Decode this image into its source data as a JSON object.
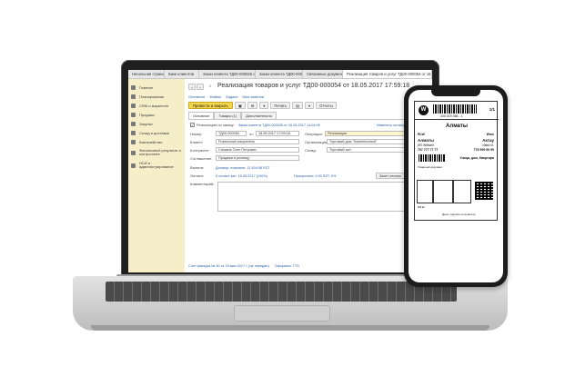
{
  "laptop_app": {
    "tabs": [
      "Начальная страница",
      "Банк клиентов",
      "Заказ клиента ТД00-000026 от 16.05.2017 14:04:09",
      "Заказ клиента ТД00-000026 от ...",
      "Связанные документы",
      "Реализация товаров и услуг ТД00-000054 от 18.05.2017 17:59:18"
    ],
    "sidebar": [
      {
        "label": "Главное"
      },
      {
        "label": "Планирование"
      },
      {
        "label": "CRM и маркетинг"
      },
      {
        "label": "Продажи"
      },
      {
        "label": "Закупки"
      },
      {
        "label": "Склад и доставка"
      },
      {
        "label": "Казначейство"
      },
      {
        "label": "Финансовый результат и контроллинг"
      },
      {
        "label": "НСИ и администрирование"
      }
    ],
    "nav": {
      "back": "←",
      "forward": "→",
      "star": "☆"
    },
    "doc_title": "Реализация товаров и услуг ТД00-000054 от 18.05.2017 17:59:18",
    "links": [
      "Основное",
      "Файлы",
      "Задачи",
      "Мои заметки"
    ],
    "toolbar": {
      "post_close": "Провести и закрыть",
      "btn2": "▣",
      "btn3": "⊞",
      "btn4": "▾",
      "print": "Печать",
      "btn6": "▤",
      "btn7": "▾",
      "reports": "Отчеты"
    },
    "form_tabs": [
      "Основное",
      "Товары (1)",
      "Дополнительно"
    ],
    "fields": {
      "issued_label": "Реализация по заказу",
      "issued_link": "Заказ клиента ТД00-000026 от 16.05.2017 14:04:09",
      "change_payment": "Изменить оплату",
      "number_label": "Номер:",
      "number_value": "ТД00-000054",
      "from_label": "от:",
      "date_value": "18.05.2017 17:59:18",
      "operation_label": "Операция:",
      "operation_value": "Реализация",
      "client_label": "Клиент:",
      "client_value": "Розничный покупатель",
      "org_label": "Организация:",
      "org_value": "Торговый дом \"Комплексный\"",
      "contractor_label": "Контрагент:",
      "contractor_value": "Сизиков Олег Петрович",
      "warehouse_label": "Склад:",
      "warehouse_value": "Торговый зал",
      "agreement_label": "Соглашение:",
      "agreement_value": "Продажи в розницу",
      "currency_label": "Валюта:",
      "currency_link": "Договор: в валюте, 11 504.98 RZT",
      "payment_label": "Оплата:",
      "payment_link": "К оплате зап. 18.05.2017 (100%)",
      "debt_link": "Просрочено: 0.00 RZT, 0%",
      "payment_btn": "Зачет оплаты",
      "comment_label": "Комментарий:"
    },
    "footer_links": [
      "Счет фактура № 60 от 18 мая 2017 г. (не передан)",
      "Оформить ТТН"
    ]
  },
  "phone_label": {
    "logo_letter": "W",
    "barcode_number": "200 019 366 - 1",
    "page": "1/1",
    "city": "Алматы",
    "from_title": "RLW",
    "from_city": "Алматы",
    "from_id": "ИП Willwell",
    "from_phone": "707 777 77 77",
    "to_title": "Wms",
    "to_city": "Актау",
    "to_name": "Иван И.",
    "to_phone": "778 999 99 99",
    "to_address": "Улица, дом, Квартира",
    "note": "Товарный документ",
    "weight_label": "0.0 кг",
    "date_label": "Дата, подпись получателя"
  }
}
